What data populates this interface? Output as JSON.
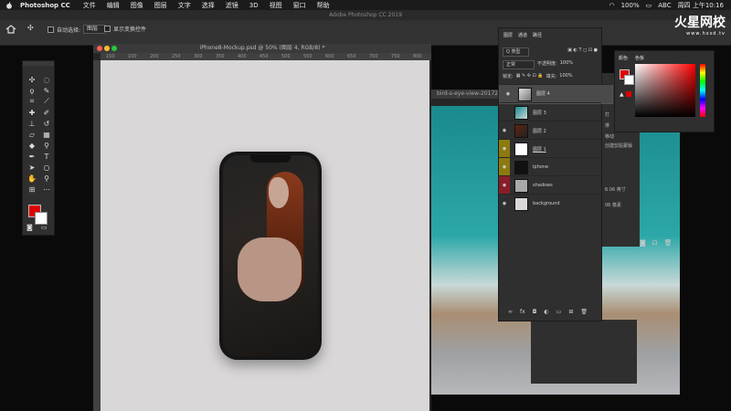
{
  "menubar": {
    "app_name": "Photoshop CC",
    "items": [
      "文件",
      "编辑",
      "图像",
      "图层",
      "文字",
      "选择",
      "滤镜",
      "3D",
      "视图",
      "窗口",
      "帮助"
    ],
    "window_title": "Adobe Photoshop CC 2019",
    "battery": "100%",
    "input": "ABC",
    "clock": "周四 上午10:16"
  },
  "options": {
    "auto_select_label": "自动选择:",
    "auto_select_value": "图层",
    "transform_label": "显示变换控件"
  },
  "document": {
    "title": "iPhone8-Mockup.psd @ 50% (图层 4, RGB/8) *",
    "ruler_ticks": [
      "150",
      "100",
      "200",
      "250",
      "300",
      "350",
      "400",
      "450",
      "500",
      "550",
      "600",
      "650",
      "700",
      "750",
      "800"
    ]
  },
  "image_window": {
    "title": "bird-s-eye-view-2017259"
  },
  "layers_panel": {
    "tabs": [
      "图层",
      "通道",
      "路径"
    ],
    "kind_filter": "Q 类型",
    "blend_mode": "正常",
    "opacity_label": "不透明度:",
    "opacity_value": "100%",
    "lock_label": "锁定:",
    "fill_label": "填充:",
    "fill_value": "100%",
    "layers": [
      {
        "name": "图层 4",
        "visible": true,
        "selected": true
      },
      {
        "name": "图层 3",
        "visible": false,
        "selected": false
      },
      {
        "name": "图层 2",
        "visible": true,
        "selected": false
      },
      {
        "name": "图层 1",
        "visible": true,
        "selected": false
      },
      {
        "name": "iphone",
        "visible": true,
        "selected": false
      },
      {
        "name": "shadows",
        "visible": true,
        "selected": false
      },
      {
        "name": "background",
        "visible": true,
        "selected": false
      }
    ]
  },
  "side_panel": {
    "lines": [
      "打",
      "排",
      "移动",
      "创建剪贴蒙版"
    ],
    "size_a": "6.06 英寸",
    "size_b": "06 像素"
  },
  "color_panel": {
    "tabs": [
      "颜色",
      "色板"
    ],
    "foreground": "#e00000",
    "background": "#ffffff"
  },
  "watermark": {
    "title": "火星网校",
    "url": "www.hxsd.tv"
  }
}
